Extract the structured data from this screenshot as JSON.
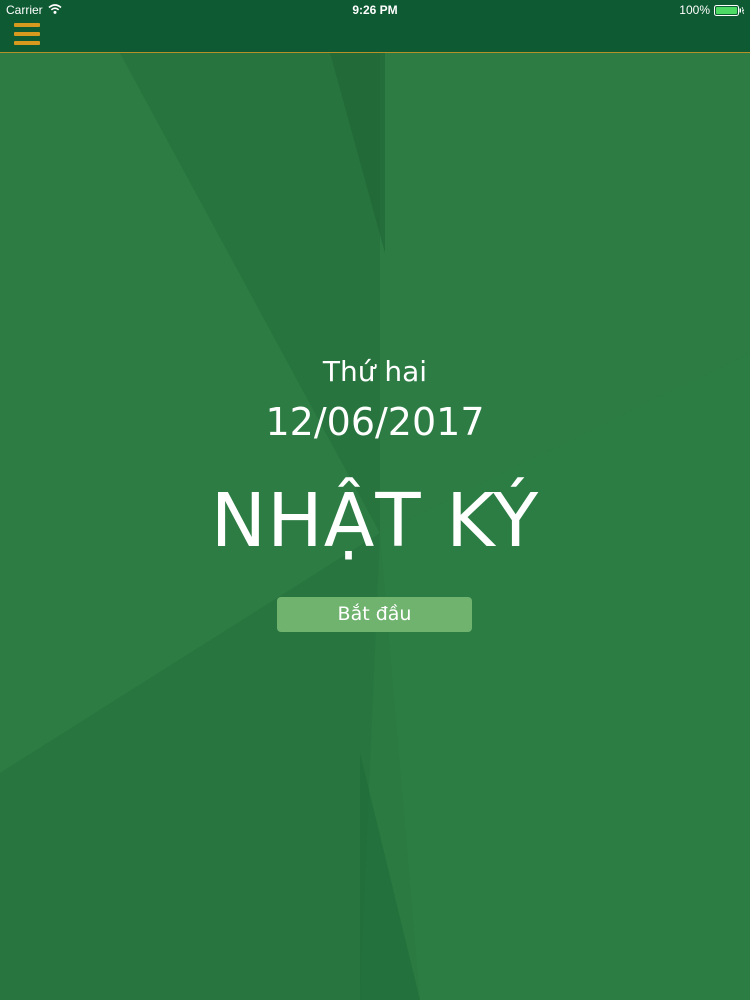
{
  "status_bar": {
    "carrier": "Carrier",
    "time": "9:26 PM",
    "battery": "100%",
    "icons": [
      "wifi-icon",
      "battery-icon"
    ]
  },
  "header": {
    "menu_icon": "hamburger-menu-icon"
  },
  "main": {
    "weekday": "Thứ hai",
    "date": "12/06/2017",
    "title": "NHẬT KÝ",
    "start_button": "Bắt đầu"
  },
  "colors": {
    "background": "#2a7a42",
    "topbar": "#0e5a33",
    "menu_icon": "#d89a1e",
    "button": "#6fb36f",
    "text": "#ffffff"
  }
}
